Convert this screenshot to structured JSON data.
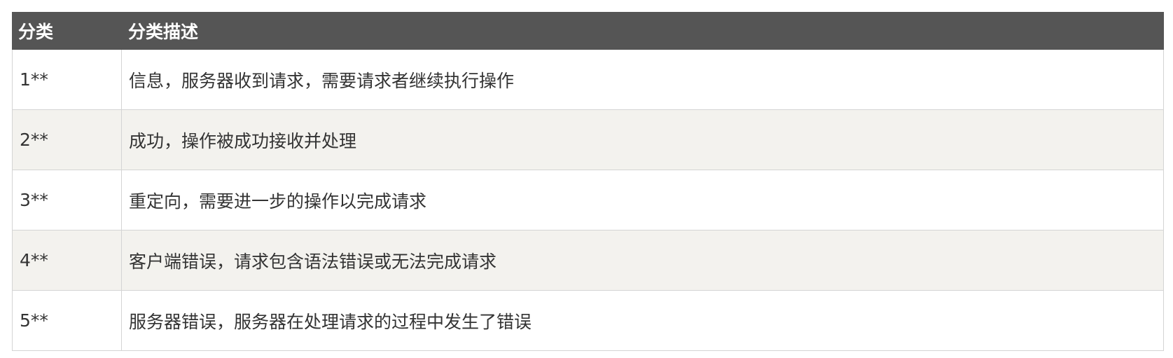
{
  "table": {
    "headers": [
      "分类",
      "分类描述"
    ],
    "rows": [
      {
        "category": "1**",
        "description": "信息，服务器收到请求，需要请求者继续执行操作"
      },
      {
        "category": "2**",
        "description": "成功，操作被成功接收并处理"
      },
      {
        "category": "3**",
        "description": "重定向，需要进一步的操作以完成请求"
      },
      {
        "category": "4**",
        "description": "客户端错误，请求包含语法错误或无法完成请求"
      },
      {
        "category": "5**",
        "description": "服务器错误，服务器在处理请求的过程中发生了错误"
      }
    ]
  },
  "colors": {
    "header_bg": "#555555",
    "header_text": "#ffffff",
    "stripe_bg": "#f3f2ee",
    "border": "#d4d4d4",
    "body_text": "#333333"
  }
}
